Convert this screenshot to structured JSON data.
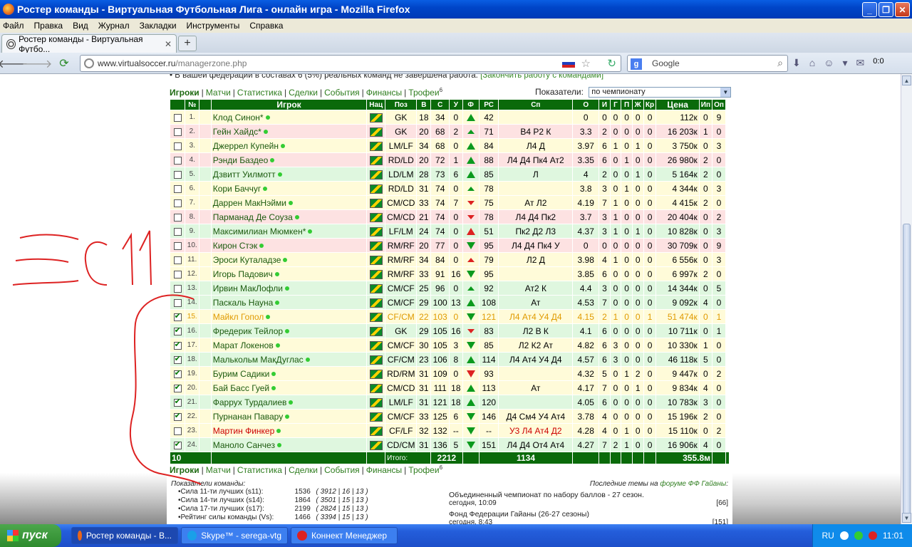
{
  "window": {
    "title": "Ростер команды - Виртуальная Футбольная Лига - онлайн игра - Mozilla Firefox"
  },
  "menu": [
    "Файл",
    "Правка",
    "Вид",
    "Журнал",
    "Закладки",
    "Инструменты",
    "Справка"
  ],
  "tab": {
    "label": "Ростер команды - Виртуальная Футбо..."
  },
  "address": {
    "url_host": "www.virtualsoccer.ru",
    "url_path": "/managerzone.php"
  },
  "search": {
    "placeholder": "Google",
    "engine_letter": "g"
  },
  "toolbar_counter": "0:0",
  "notice": {
    "text": "В вашей федерации в составах 6 (5%) реальных команд не завершена работа.",
    "link": "[Закончить работу с командами]"
  },
  "nav": {
    "items": [
      "Игроки",
      "Матчи",
      "Статистика",
      "Сделки",
      "События",
      "Финансы",
      "Трофеи"
    ],
    "trophy_sup": "6"
  },
  "indicators": {
    "label": "Показатели:",
    "selected": "по чемпионату"
  },
  "table": {
    "headers": [
      "№",
      "Игрок",
      "Нац",
      "Поз",
      "В",
      "С",
      "У",
      "Ф",
      "РС",
      "Сп",
      "О",
      "И",
      "Г",
      "П",
      "Ж",
      "Кр",
      "Цена",
      "Ип",
      "Оп"
    ],
    "rows": [
      {
        "n": "1.",
        "name": "Клод Синон*",
        "poz": "GK",
        "v": "18",
        "s": "34",
        "u": "0",
        "f": "up",
        "rs": "42",
        "sp": "",
        "o": "0",
        "i": "0",
        "g": "0",
        "p": "0",
        "zh": "0",
        "kr": "0",
        "cena": "112к",
        "ip": "0",
        "op": "9",
        "cls": "y",
        "chk": false
      },
      {
        "n": "2.",
        "name": "Гейн Хайдс*",
        "poz": "GK",
        "v": "20",
        "s": "68",
        "u": "2",
        "f": "sm",
        "rs": "71",
        "sp": "В4 Р2 К",
        "o": "3.3",
        "i": "2",
        "g": "0",
        "p": "0",
        "zh": "0",
        "kr": "0",
        "cena": "16 203к",
        "ip": "1",
        "op": "0",
        "cls": "p",
        "chk": false
      },
      {
        "n": "3.",
        "name": "Джеррел Купейн",
        "poz": "LM/LF",
        "v": "34",
        "s": "68",
        "u": "0",
        "f": "up",
        "rs": "84",
        "sp": "Л4 Д",
        "o": "3.97",
        "i": "6",
        "g": "1",
        "p": "0",
        "zh": "1",
        "kr": "0",
        "cena": "3 750к",
        "ip": "0",
        "op": "3",
        "cls": "y",
        "chk": false
      },
      {
        "n": "4.",
        "name": "Рэнди Баздео",
        "poz": "RD/LD",
        "v": "20",
        "s": "72",
        "u": "1",
        "f": "up",
        "rs": "88",
        "sp": "Л4 Д4 Пк4 Ат2",
        "o": "3.35",
        "i": "6",
        "g": "0",
        "p": "1",
        "zh": "0",
        "kr": "0",
        "cena": "26 980к",
        "ip": "2",
        "op": "0",
        "cls": "p",
        "chk": false
      },
      {
        "n": "5.",
        "name": "Дзвитт Уилмотт",
        "poz": "LD/LM",
        "v": "28",
        "s": "73",
        "u": "6",
        "f": "up",
        "rs": "85",
        "sp": "Л",
        "o": "4",
        "i": "2",
        "g": "0",
        "p": "0",
        "zh": "1",
        "kr": "0",
        "cena": "5 164к",
        "ip": "2",
        "op": "0",
        "cls": "g",
        "chk": false
      },
      {
        "n": "6.",
        "name": "Кори Баччуг",
        "poz": "RD/LD",
        "v": "31",
        "s": "74",
        "u": "0",
        "f": "sm",
        "rs": "78",
        "sp": "",
        "o": "3.8",
        "i": "3",
        "g": "0",
        "p": "1",
        "zh": "0",
        "kr": "0",
        "cena": "4 344к",
        "ip": "0",
        "op": "3",
        "cls": "y",
        "chk": false
      },
      {
        "n": "7.",
        "name": "Даррен МакНэйми",
        "poz": "CM/CD",
        "v": "33",
        "s": "74",
        "u": "7",
        "f": "dsm",
        "rs": "75",
        "sp": "Ат Л2",
        "o": "4.19",
        "i": "7",
        "g": "1",
        "p": "0",
        "zh": "0",
        "kr": "0",
        "cena": "4 415к",
        "ip": "2",
        "op": "0",
        "cls": "y",
        "chk": false
      },
      {
        "n": "8.",
        "name": "Парманад Де Соуза",
        "poz": "CM/CD",
        "v": "21",
        "s": "74",
        "u": "0",
        "f": "dsm",
        "rs": "78",
        "sp": "Л4 Д4 Пк2",
        "o": "3.7",
        "i": "3",
        "g": "1",
        "p": "0",
        "zh": "0",
        "kr": "0",
        "cena": "20 404к",
        "ip": "0",
        "op": "2",
        "cls": "p",
        "chk": false
      },
      {
        "n": "9.",
        "name": "Максимилиан Мюмкен*",
        "poz": "LF/LM",
        "v": "24",
        "s": "74",
        "u": "0",
        "f": "upr",
        "rs": "51",
        "sp": "Пк2 Д2 Л3",
        "o": "4.37",
        "i": "3",
        "g": "1",
        "p": "0",
        "zh": "1",
        "kr": "0",
        "cena": "10 828к",
        "ip": "0",
        "op": "3",
        "cls": "g",
        "chk": false
      },
      {
        "n": "10.",
        "name": "Кирон Стэк",
        "poz": "RM/RF",
        "v": "20",
        "s": "77",
        "u": "0",
        "f": "dn",
        "rs": "95",
        "sp": "Л4 Д4 Пк4 У",
        "o": "0",
        "i": "0",
        "g": "0",
        "p": "0",
        "zh": "0",
        "kr": "0",
        "cena": "30 709к",
        "ip": "0",
        "op": "9",
        "cls": "p",
        "chk": false
      },
      {
        "n": "11.",
        "name": "Эроси Куталадзе",
        "poz": "RM/RF",
        "v": "34",
        "s": "84",
        "u": "0",
        "f": "smr",
        "rs": "79",
        "sp": "Л2 Д",
        "o": "3.98",
        "i": "4",
        "g": "1",
        "p": "0",
        "zh": "0",
        "kr": "0",
        "cena": "6 556к",
        "ip": "0",
        "op": "3",
        "cls": "y",
        "chk": false
      },
      {
        "n": "12.",
        "name": "Игорь Падович",
        "poz": "RM/RF",
        "v": "33",
        "s": "91",
        "u": "16",
        "f": "dn",
        "rs": "95",
        "sp": "",
        "o": "3.85",
        "i": "6",
        "g": "0",
        "p": "0",
        "zh": "0",
        "kr": "0",
        "cena": "6 997к",
        "ip": "2",
        "op": "0",
        "cls": "y",
        "chk": false
      },
      {
        "n": "13.",
        "name": "Ирвин МакЛофли",
        "poz": "CM/CF",
        "v": "25",
        "s": "96",
        "u": "0",
        "f": "sm",
        "rs": "92",
        "sp": "Ат2 К",
        "o": "4.4",
        "i": "3",
        "g": "0",
        "p": "0",
        "zh": "0",
        "kr": "0",
        "cena": "14 344к",
        "ip": "0",
        "op": "5",
        "cls": "g",
        "chk": false
      },
      {
        "n": "14.",
        "name": "Паскаль Науна",
        "poz": "CM/CF",
        "v": "29",
        "s": "100",
        "u": "13",
        "f": "up",
        "rs": "108",
        "sp": "Ат",
        "o": "4.53",
        "i": "7",
        "g": "0",
        "p": "0",
        "zh": "0",
        "kr": "0",
        "cena": "9 092к",
        "ip": "4",
        "op": "0",
        "cls": "g",
        "chk": false
      },
      {
        "n": "15.",
        "name": "Майкл Гопол",
        "poz": "CF/CM",
        "v": "22",
        "s": "103",
        "u": "0",
        "f": "dn",
        "rs": "121",
        "sp": "Л4 Ат4 У4 Д4",
        "o": "4.15",
        "i": "2",
        "g": "1",
        "p": "0",
        "zh": "0",
        "kr": "1",
        "cena": "51 474к",
        "ip": "0",
        "op": "1",
        "cls": "y orange",
        "chk": true
      },
      {
        "n": "16.",
        "name": "Фредерик Тейлор",
        "poz": "GK",
        "v": "29",
        "s": "105",
        "u": "16",
        "f": "dsm",
        "rs": "83",
        "sp": "Л2 В К",
        "o": "4.1",
        "i": "6",
        "g": "0",
        "p": "0",
        "zh": "0",
        "kr": "0",
        "cena": "10 711к",
        "ip": "0",
        "op": "1",
        "cls": "g",
        "chk": true
      },
      {
        "n": "17.",
        "name": "Марат Локенов",
        "poz": "CM/CF",
        "v": "30",
        "s": "105",
        "u": "3",
        "f": "dn",
        "rs": "85",
        "sp": "Л2 К2 Ат",
        "o": "4.82",
        "i": "6",
        "g": "3",
        "p": "0",
        "zh": "0",
        "kr": "0",
        "cena": "10 330к",
        "ip": "1",
        "op": "0",
        "cls": "y",
        "chk": true
      },
      {
        "n": "18.",
        "name": "Малькольм МакДуглас",
        "poz": "CF/CM",
        "v": "23",
        "s": "106",
        "u": "8",
        "f": "up",
        "rs": "114",
        "sp": "Л4 Ат4 У4 Д4",
        "o": "4.57",
        "i": "6",
        "g": "3",
        "p": "0",
        "zh": "0",
        "kr": "0",
        "cena": "46 118к",
        "ip": "5",
        "op": "0",
        "cls": "g",
        "chk": true
      },
      {
        "n": "19.",
        "name": "Бурим Садики",
        "poz": "RD/RM",
        "v": "31",
        "s": "109",
        "u": "0",
        "f": "dnr",
        "rs": "93",
        "sp": "",
        "o": "4.32",
        "i": "5",
        "g": "0",
        "p": "1",
        "zh": "2",
        "kr": "0",
        "cena": "9 447к",
        "ip": "0",
        "op": "2",
        "cls": "y",
        "chk": true
      },
      {
        "n": "20.",
        "name": "Бай Басс Гуей",
        "poz": "CM/CD",
        "v": "31",
        "s": "111",
        "u": "18",
        "f": "up",
        "rs": "113",
        "sp": "Ат",
        "o": "4.17",
        "i": "7",
        "g": "0",
        "p": "0",
        "zh": "1",
        "kr": "0",
        "cena": "9 834к",
        "ip": "4",
        "op": "0",
        "cls": "y",
        "chk": true
      },
      {
        "n": "21.",
        "name": "Фаррух Турдалиев",
        "poz": "LM/LF",
        "v": "31",
        "s": "121",
        "u": "18",
        "f": "up",
        "rs": "120",
        "sp": "",
        "o": "4.05",
        "i": "6",
        "g": "0",
        "p": "0",
        "zh": "0",
        "kr": "0",
        "cena": "10 783к",
        "ip": "3",
        "op": "0",
        "cls": "g",
        "chk": true
      },
      {
        "n": "22.",
        "name": "Пурнанан Павару",
        "poz": "CM/CF",
        "v": "33",
        "s": "125",
        "u": "6",
        "f": "dn",
        "rs": "146",
        "sp": "Д4 См4 У4 Ат4",
        "o": "3.78",
        "i": "4",
        "g": "0",
        "p": "0",
        "zh": "0",
        "kr": "0",
        "cena": "15 196к",
        "ip": "2",
        "op": "0",
        "cls": "y",
        "chk": true
      },
      {
        "n": "23.",
        "name": "Мартин Финкер",
        "poz": "CF/LF",
        "v": "32",
        "s": "132",
        "u": "--",
        "f": "dn",
        "rs": "--",
        "sp": "У3 Л4 Ат4 Д2",
        "o": "4.28",
        "i": "4",
        "g": "0",
        "p": "1",
        "zh": "0",
        "kr": "0",
        "cena": "15 110к",
        "ip": "0",
        "op": "2",
        "cls": "y red",
        "chk": false
      },
      {
        "n": "24.",
        "name": "Маноло Санчез",
        "poz": "CD/CM",
        "v": "31",
        "s": "136",
        "u": "5",
        "f": "dn",
        "rs": "151",
        "sp": "Л4 Д4 От4 Ат4",
        "o": "4.27",
        "i": "7",
        "g": "2",
        "p": "1",
        "zh": "0",
        "kr": "0",
        "cena": "16 906к",
        "ip": "4",
        "op": "0",
        "cls": "g",
        "chk": true
      }
    ],
    "summary": {
      "count": "10",
      "label": "Итого:",
      "s": "2212",
      "rs": "1134",
      "cena": "355.8м"
    }
  },
  "stats": {
    "title": "Показатели команды:",
    "rows": [
      {
        "k": "Сила 11-ти лучших (s11):",
        "v": "1536",
        "extra": "( 3912 | 16 | 13 )"
      },
      {
        "k": "Сила 14-ти лучших (s14):",
        "v": "1864",
        "extra": "( 3501 | 15 | 13 )"
      },
      {
        "k": "Сила 17-ти лучших (s17):",
        "v": "2199",
        "extra": "( 2824 | 15 | 13 )"
      },
      {
        "k": "Рейтинг силы команды (Vs):",
        "v": "1466",
        "extra": "( 3394 | 15 | 13 )"
      }
    ]
  },
  "news": {
    "header_prefix": "Последние темы на",
    "header_link": "форуме ФФ Гайаны",
    "header_suffix": ":",
    "items": [
      {
        "title": "Объединенный чемпионат по набору баллов - 27 сезон.",
        "when": "сегодня, 10:09",
        "count": "[66]"
      },
      {
        "title": "Фонд Федерации Гайаны (26-27 сезоны)",
        "when": "сегодня, 8:43",
        "count": "[151]"
      }
    ]
  },
  "taskbar": {
    "start": "пуск",
    "buttons": [
      "Ростер команды - В...",
      "Skype™ - serega-vtg",
      "Коннект Менеджер"
    ],
    "lang": "RU",
    "time": "11:01"
  },
  "colors": {
    "header_green": "#0a6a0a",
    "link_green": "#2e7d1e",
    "taskbar_blue": "#245edb"
  }
}
